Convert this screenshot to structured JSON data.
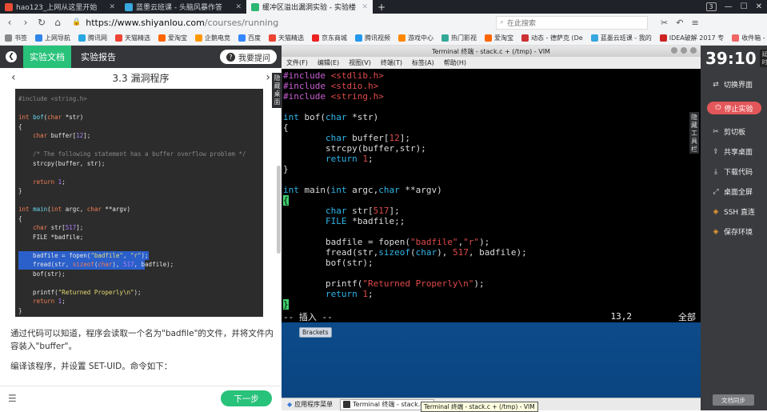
{
  "browser": {
    "tabs": [
      {
        "title": "hao123_上网从这里开始",
        "color": "#e94b35"
      },
      {
        "title": "蓝墨云班课 - 头脑风暴作答",
        "color": "#37a8e0"
      },
      {
        "title": "缓冲区溢出漏洞实验 - 实验楼",
        "color": "#2bb673",
        "active": true
      }
    ],
    "new_tab": "+",
    "tab_count": "3",
    "url_host": "https://www.shiyanlou.com",
    "url_path": "/courses/running",
    "search_placeholder": "在此搜索",
    "bookmarks": [
      "书签",
      "上网导航",
      "腾讯网",
      "天猫精选",
      "爱淘宝",
      "企鹅电竞",
      "百度",
      "天猫精选",
      "京东商城",
      "腾讯视频",
      "游戏中心",
      "热门影视",
      "爱淘宝",
      "动态 - 德萨克 (De",
      "蓝墨云班课 - 我的",
      "IDEA破解 2017 专",
      "收件箱 - 短消息"
    ]
  },
  "lab": {
    "tab_doc": "实验文档",
    "tab_report": "实验报告",
    "ask_label": "我要提问",
    "ask_icon": "?",
    "lesson_title": "3.3 漏洞程序",
    "prev": "‹",
    "next": "›",
    "code_lines": [
      {
        "h": "<span class='c'>#include &lt;string.h&gt;</span>"
      },
      {
        "h": ""
      },
      {
        "h": "<span class='k'>int</span> <span class='f'>bof</span>(<span class='k'>char</span> *str)"
      },
      {
        "h": "{"
      },
      {
        "h": "    <span class='k'>char</span> buffer[<span class='n'>12</span>];"
      },
      {
        "h": ""
      },
      {
        "h": "    <span class='c'>/* The following statement has a buffer overflow problem */</span>"
      },
      {
        "h": "    strcpy(buffer, str);"
      },
      {
        "h": ""
      },
      {
        "h": "    <span class='k'>return</span> <span class='n'>1</span>;"
      },
      {
        "h": "}"
      },
      {
        "h": ""
      },
      {
        "h": "<span class='k'>int</span> <span class='f'>main</span>(<span class='k'>int</span> argc, <span class='k'>char</span> **argv)"
      },
      {
        "h": "{"
      },
      {
        "h": "    <span class='k'>char</span> str[<span class='n'>517</span>];"
      },
      {
        "h": "    FILE *badfile;"
      },
      {
        "h": ""
      },
      {
        "h": "    badfile = fopen(<span class='s'>\"badfile\"</span>, <span class='s'>\"r\"</span>);",
        "sel": true
      },
      {
        "h": "    fread(str, <span class='k'>sizeof</span>(<span class='k'>char</span>), <span class='n'>517</span>, b",
        "sel": true,
        "rest": "adfile);"
      },
      {
        "h": "    bof(str);"
      },
      {
        "h": ""
      },
      {
        "h": "    printf(<span class='s'>\"Returned Properly\\n\"</span>);"
      },
      {
        "h": "    <span class='k'>return</span> <span class='n'>1</span>;"
      },
      {
        "h": "}"
      }
    ],
    "para1": "通过代码可以知道，程序会读取一个名为\"badfile\"的文件，并将文件内容装入\"buffer\"。",
    "para2": "编译该程序，并设置 SET-UID。命令如下：",
    "next_step": "下一步",
    "list_icon": "☰"
  },
  "desktop": {
    "hide_desktop": "隐藏桌面",
    "hide_toolbar": "隐藏工具栏",
    "term_title": "Terminal 终端 - stack.c + (/tmp) - VIM",
    "term_menu": [
      "文件(F)",
      "编辑(E)",
      "视图(V)",
      "终端(T)",
      "标签(A)",
      "帮助(H)"
    ],
    "vim_lines": [
      "<span class='vp'>#include</span> <span class='vs'>&lt;stdlib.h&gt;</span>",
      "<span class='vp'>#include</span> <span class='vs'>&lt;stdio.h&gt;</span>",
      "<span class='vp'>#include</span> <span class='vs'>&lt;string.h&gt;</span>",
      "",
      "<span class='vk'>int</span> bof(<span class='vk'>char</span> *str)",
      "{",
      "        <span class='vk'>char</span> buffer[<span class='vn'>12</span>];",
      "        strcpy(buffer,str);",
      "        <span class='vk'>return</span> <span class='vn'>1</span>;",
      "}",
      "",
      "<span class='vk'>int</span> main(<span class='vk'>int</span> argc,<span class='vk'>char</span> **argv)",
      "<span class='vcur'>{</span>",
      "        <span class='vk'>char</span> str[<span class='vn'>517</span>];",
      "        <span class='vk'>FILE</span> *badfile;;",
      "",
      "        badfile = fopen(<span class='vs'>\"badfile\"</span>,<span class='vs'>\"r\"</span>);",
      "        fread(str,<span class='vk'>sizeof</span>(<span class='vk'>char</span>), <span class='vn'>517</span>, badfile);",
      "        bof(str);",
      "",
      "        printf(<span class='vs'>\"Returned Properly\\n\"</span>);",
      "        <span class='vk'>return</span> <span class='vn'>1</span>;",
      "<span class='vcur'>}</span>"
    ],
    "status_mode": "-- 插入 --",
    "status_pos": "13,2",
    "status_all": "全部",
    "brackets": "Brackets",
    "taskbar_apps": "应用程序菜单",
    "taskbar_term": "Terminal 终端 - stack.c +",
    "tooltip": "Terminal 终端 - stack.c + (/tmp) - VIM"
  },
  "side": {
    "timer": "39:10",
    "timer_badge": "延时",
    "switch": "切换界面",
    "stop": "停止实验",
    "clipboard": "剪切板",
    "share": "共享桌面",
    "download": "下载代码",
    "fullscreen": "桌面全屏",
    "ssh": "SSH 直连",
    "save": "保存环境",
    "docsync": "文档同步"
  },
  "colors": {
    "accent": "#28c27a",
    "stop": "#e3575a",
    "selection": "#2b5fc9"
  }
}
